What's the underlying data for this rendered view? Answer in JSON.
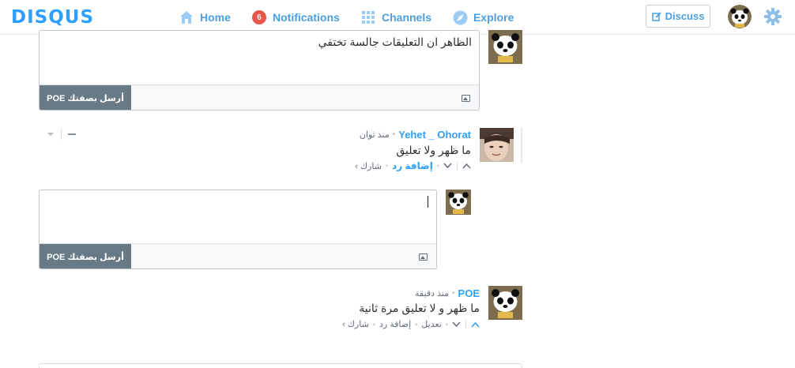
{
  "nav": {
    "logo": "DISQUS",
    "home": "Home",
    "notifications": "Notifications",
    "notifications_count": "6",
    "channels": "Channels",
    "explore": "Explore",
    "discuss": "Discuss"
  },
  "top_reply": {
    "text": "الظاهر ان التعليقات جالسة تختفي",
    "post_button": "أرسل بصفتك POE"
  },
  "comment1": {
    "author": "Yehet _ Ohorat",
    "time": "منذ ثوان",
    "body": "ما ظهر ولا تعليق",
    "reply": "إضافة رد",
    "share": "شارك ›"
  },
  "reply_box": {
    "text": "",
    "post_button": "أرسل بصفتك POE"
  },
  "comment2": {
    "author": "POE",
    "time": "منذ دقيقة",
    "body": "ما ظهر و لا تعليق مرة ثانية",
    "edit": "تعديل",
    "reply": "إضافة رد",
    "share": "شارك ›"
  },
  "colors": {
    "accent": "#2e9fff",
    "post_button": "#687a86",
    "badge": "#e8574a"
  },
  "icons": [
    "home-icon",
    "channels-icon",
    "explore-icon",
    "edit-icon",
    "gear-icon",
    "image-icon",
    "upvote-icon",
    "downvote-icon",
    "collapse-icon",
    "dropdown-icon"
  ]
}
